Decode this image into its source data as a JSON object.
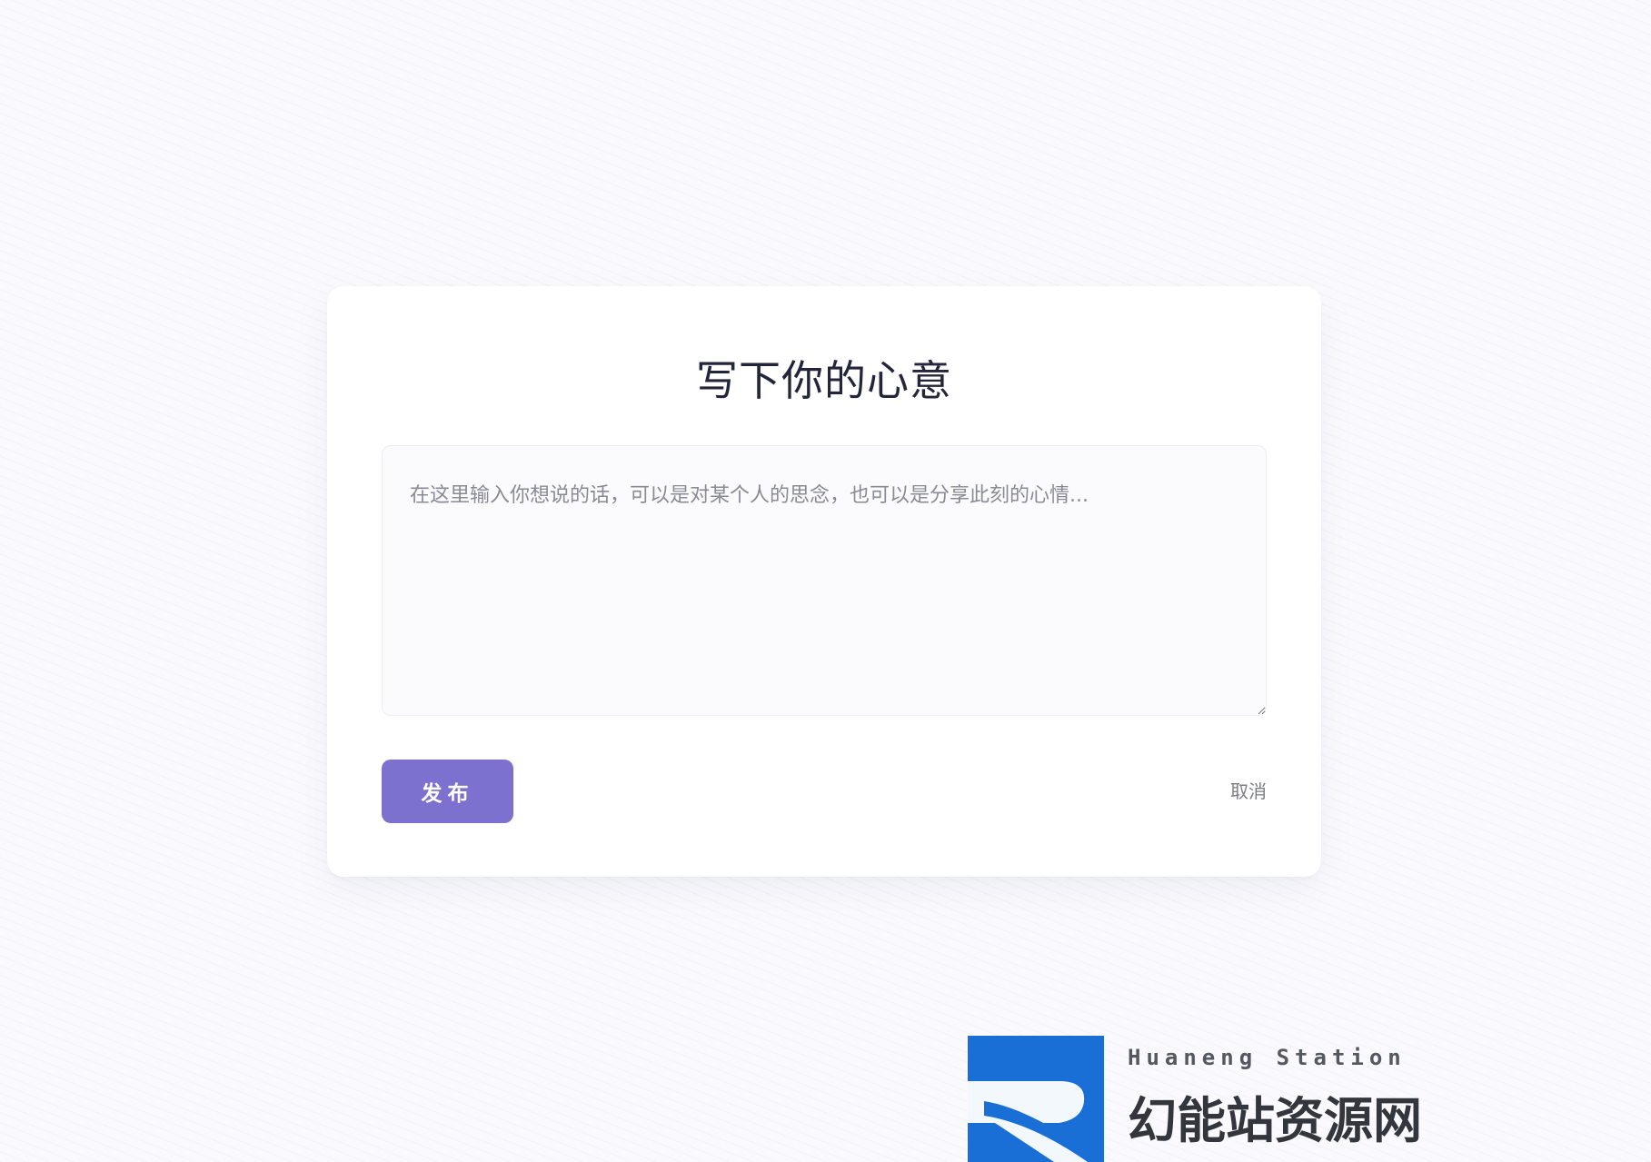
{
  "card": {
    "title": "写下你的心意",
    "textarea_placeholder": "在这里输入你想说的话，可以是对某个人的思念，也可以是分享此刻的心情...",
    "textarea_value": ""
  },
  "actions": {
    "publish_label": "发布",
    "cancel_label": "取消"
  },
  "brand_logo": {
    "text_top": "Huaneng Station",
    "text_main": "幻能站资源网"
  },
  "colors": {
    "page_background": "#fafafe",
    "card_background": "#ffffff",
    "primary_button": "#7c71cf",
    "title_text": "#23263a",
    "logo_blue": "#1a6fd6"
  }
}
